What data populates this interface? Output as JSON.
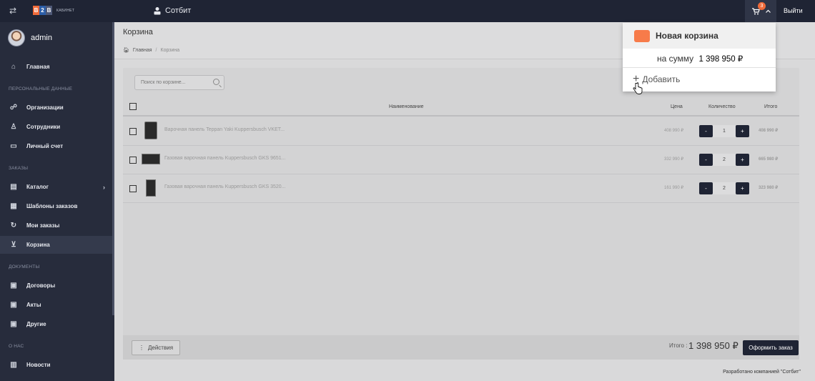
{
  "topbar": {
    "logo_letters": [
      "B",
      "2",
      "B"
    ],
    "logo_sub": "КАБИНЕТ",
    "company": "Сотбит",
    "cart_count": "3",
    "logout": "Выйти"
  },
  "sidebar": {
    "user": "admin",
    "home": "Главная",
    "sections": {
      "personal": "ПЕРСОНАЛЬНЫЕ ДАННЫЕ",
      "orders": "ЗАКАЗЫ",
      "documents": "ДОКУМЕНТЫ",
      "about": "О НАС"
    },
    "items": {
      "orgs": "Организации",
      "staff": "Сотрудники",
      "account": "Личный счет",
      "catalog": "Каталог",
      "templates": "Шаблоны заказов",
      "my_orders": "Мои заказы",
      "cart": "Корзина",
      "contracts": "Договоры",
      "acts": "Акты",
      "other": "Другие",
      "news": "Новости"
    }
  },
  "page": {
    "title": "Корзина",
    "breadcrumb_home": "Главная",
    "breadcrumb_sep": "/",
    "breadcrumb_current": "Корзина"
  },
  "cart": {
    "search_placeholder": "Поиск по корзине...",
    "columns": {
      "name": "Наименование",
      "price": "Цена",
      "qty": "Количество",
      "total": "Итого"
    },
    "rows": [
      {
        "title": "Варочная панель Teppan Yaki Kuppersbusch VKET...",
        "price": "408 990 ₽",
        "qty": "1",
        "total": "408 990 ₽"
      },
      {
        "title": "Газовая варочная панель Kuppersbusch GKS 9651...",
        "price": "332 990 ₽",
        "qty": "2",
        "total": "665 980 ₽"
      },
      {
        "title": "Газовая варочная панель Kuppersbusch GKS 3520...",
        "price": "161 990 ₽",
        "qty": "2",
        "total": "323 980 ₽"
      }
    ],
    "minus": "-",
    "plus": "+",
    "actions": "Действия",
    "sum_label": "Итого :",
    "sum_value": "1 398 950 ₽",
    "order_button": "Оформить заказ"
  },
  "dropdown": {
    "cart_name": "Новая корзина",
    "sum_label": "на сумму",
    "sum_value": "1 398 950 ₽",
    "add": "Добавить",
    "accent_color": "#f77b4a"
  },
  "footer": {
    "credits": "Разработано компанией \"Сотбит\""
  }
}
